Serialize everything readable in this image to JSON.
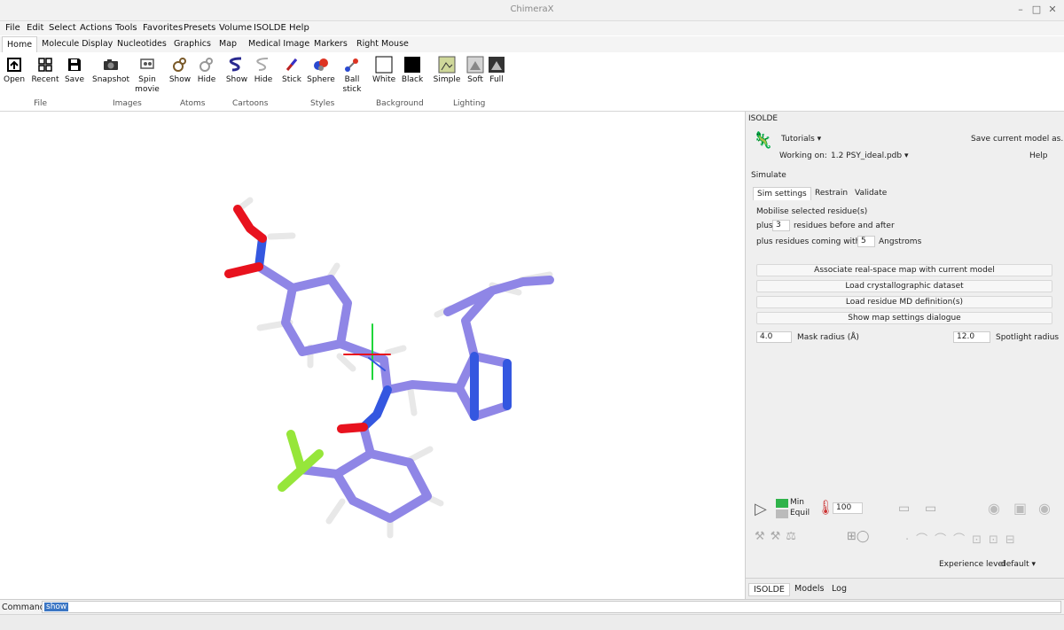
{
  "window": {
    "title": "ChimeraX"
  },
  "menubar": [
    "File",
    "Edit",
    "Select",
    "Actions",
    "Tools",
    "Favorites",
    "Presets",
    "Volume",
    "ISOLDE",
    "Help"
  ],
  "toolbar_tabs": [
    "Home",
    "Molecule Display",
    "Nucleotides",
    "Graphics",
    "Map",
    "Medical Image",
    "Markers",
    "Right Mouse"
  ],
  "ribbon": {
    "buttons": {
      "open": "Open",
      "recent": "Recent",
      "save": "Save",
      "snapshot": "Snapshot",
      "spin": "Spin movie",
      "atoms_show": "Show",
      "atoms_hide": "Hide",
      "cart_show": "Show",
      "cart_hide": "Hide",
      "stick": "Stick",
      "sphere": "Sphere",
      "ball": "Ball stick",
      "white": "White",
      "black": "Black",
      "simple": "Simple",
      "soft": "Soft",
      "full": "Full"
    },
    "groups": {
      "file": "File",
      "images": "Images",
      "atoms": "Atoms",
      "cartoons": "Cartoons",
      "styles": "Styles",
      "background": "Background",
      "lighting": "Lighting"
    }
  },
  "panel": {
    "title": "ISOLDE",
    "tutorials": "Tutorials",
    "save_model": "Save current model as...",
    "working_on_label": "Working on:",
    "working_on_value": "1.2  PSY_ideal.pdb",
    "help": "Help",
    "simulate": "Simulate",
    "subtabs": [
      "Sim settings",
      "Restrain",
      "Validate"
    ],
    "mobilise": "Mobilise selected residue(s)",
    "plus": "plus",
    "plus_value": "3",
    "residues_before_after": "residues before and after",
    "plus_contact": "plus residues coming within",
    "contact_value": "5",
    "angstroms": "Angstroms",
    "buttons": {
      "associate": "Associate real-space map with current model",
      "load_xtal": "Load crystallographic dataset",
      "load_md": "Load residue MD definition(s)",
      "map_settings": "Show map settings dialogue"
    },
    "mask_value": "4.0",
    "mask_label": "Mask radius (Å)",
    "spotlight_value": "12.0",
    "spotlight_label": "Spotlight radius",
    "min_label": "Min",
    "equil_label": "Equil",
    "temperature": "100",
    "experience_label": "Experience level",
    "experience_value": "default",
    "bottom_tabs": [
      "ISOLDE",
      "Models",
      "Log"
    ]
  },
  "command": {
    "label": "Command:",
    "value": "show"
  },
  "colors": {
    "carbon": "#8f86e6",
    "oxygen": "#e8121e",
    "nitrogen": "#3457e0",
    "fluorine": "#96e63a",
    "hydrogen": "#f4f4f4",
    "accent": "#3b76c4"
  }
}
